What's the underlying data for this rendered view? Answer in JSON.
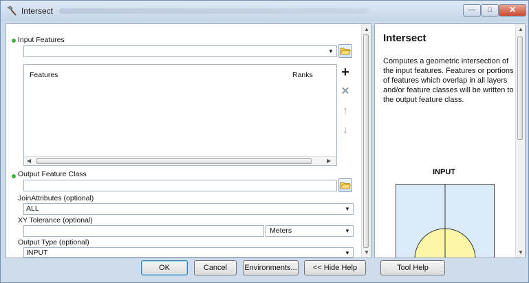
{
  "window": {
    "title": "Intersect"
  },
  "form": {
    "input_features_label": "Input Features",
    "input_features_value": "",
    "features_col": "Features",
    "ranks_col": "Ranks",
    "output_label": "Output Feature Class",
    "output_value": "",
    "join_label": "JoinAttributes (optional)",
    "join_value": "ALL",
    "xy_label": "XY Tolerance (optional)",
    "xy_value": "",
    "xy_units": "Meters",
    "output_type_label": "Output Type (optional)",
    "output_type_value": "INPUT"
  },
  "help": {
    "title": "Intersect",
    "body": "Computes a geometric intersection of the input features. Features or portions of features which overlap in all layers and/or feature classes will be written to the output feature class.",
    "diagram_caption": "INPUT"
  },
  "buttons": {
    "ok": "OK",
    "cancel": "Cancel",
    "environments": "Environments...",
    "hide_help": "<< Hide Help",
    "tool_help": "Tool Help"
  },
  "icons": {
    "title": "hammer-icon",
    "folder": "open-folder-icon",
    "add": "plus-icon",
    "remove": "x-icon",
    "up": "arrow-up-icon",
    "down": "arrow-down-icon"
  },
  "colors": {
    "required_dot": "#3fb33f",
    "diagram_fill": "#dbeaf7",
    "circle_fill": "#fbf6a8"
  }
}
